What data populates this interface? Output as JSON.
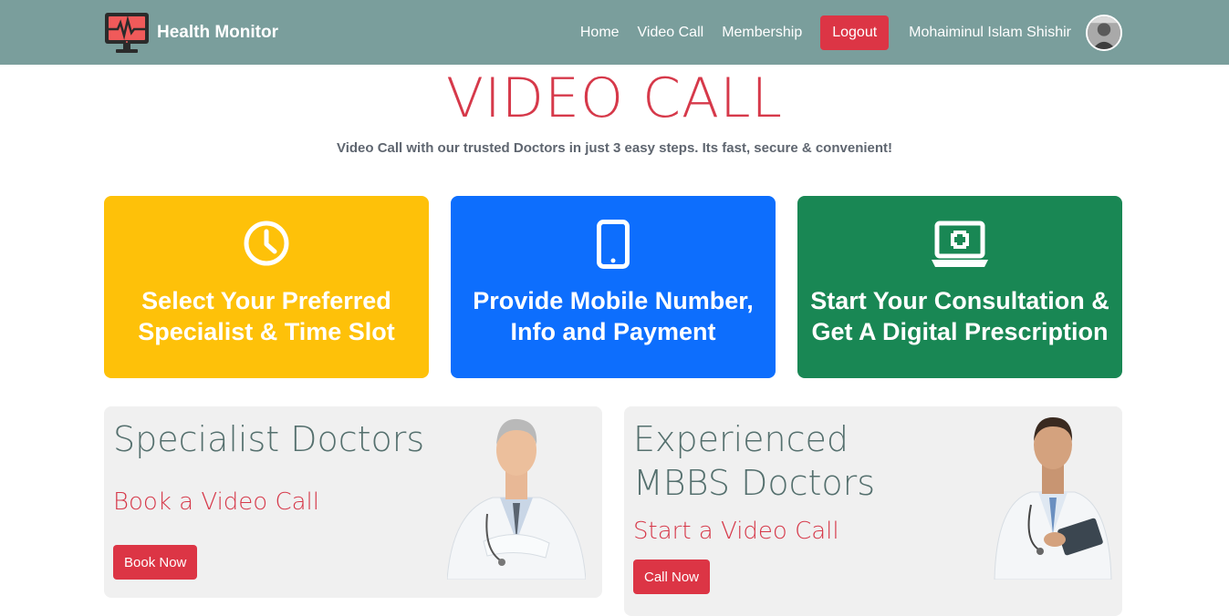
{
  "brand": {
    "name": "Health Monitor",
    "icon": "heart-monitor-icon"
  },
  "nav": {
    "links": [
      "Home",
      "Video Call",
      "Membership"
    ],
    "logout_label": "Logout",
    "user_name": "Mohaiminul Islam Shishir"
  },
  "header": {
    "title": "VIDEO CALL",
    "subtitle": "Video Call with our trusted Doctors in just 3 easy steps. Its fast, secure & convenient!"
  },
  "steps": [
    {
      "text": "Select Your Preferred Specialist & Time Slot",
      "icon": "clock-icon",
      "color": "#fec109"
    },
    {
      "text": "Provide Mobile Number, Info and Payment",
      "icon": "mobile-phone-icon",
      "color": "#0d6efd"
    },
    {
      "text": "Start Your Consultation & Get A Digital Prescription",
      "icon": "laptop-medical-icon",
      "color": "#198754"
    }
  ],
  "cards": [
    {
      "title": "Specialist Doctors",
      "subtitle": "Book a Video Call",
      "button": "Book Now"
    },
    {
      "title": "Experienced MBBS Doctors",
      "subtitle": "Start a Video Call",
      "button": "Call Now"
    }
  ],
  "colors": {
    "navbar": "#7a9e9c",
    "accent": "#dc3545",
    "title": "#d6394a"
  }
}
